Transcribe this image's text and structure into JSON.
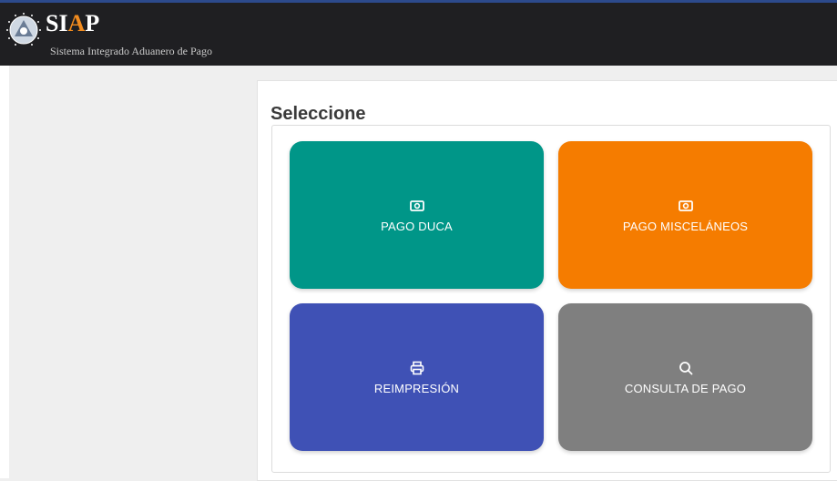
{
  "header": {
    "brand_prefix": "SI",
    "brand_accent": "A",
    "brand_suffix": "P",
    "subtitle": "Sistema Integrado Aduanero de Pago",
    "bar_color": "#1f1f22",
    "accent_color": "#f28c1f"
  },
  "main": {
    "heading": "Seleccione"
  },
  "tiles": [
    {
      "label": "PAGO DUCA",
      "icon": "money-icon",
      "color": "#009688"
    },
    {
      "label": "PAGO MISCELÁNEOS",
      "icon": "money-icon",
      "color": "#f57c00"
    },
    {
      "label": "REIMPRESIÓN",
      "icon": "printer-icon",
      "color": "#3f51b5"
    },
    {
      "label": "CONSULTA DE PAGO",
      "icon": "search-icon",
      "color": "#7f7f7f"
    }
  ]
}
